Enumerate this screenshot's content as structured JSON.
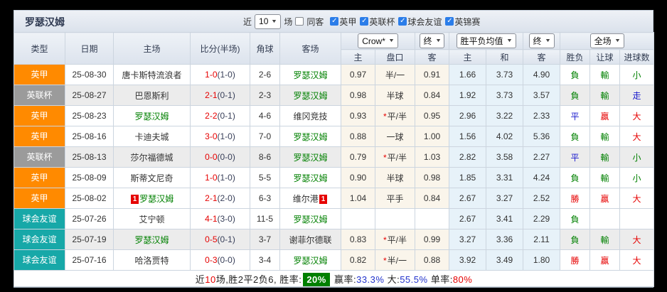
{
  "colors": {
    "league_badge": {
      "英甲": "#FF8A00",
      "英联杯": "#9B9B9B",
      "球会友谊": "#17A8A8"
    },
    "result_text": {
      "green": "#008000",
      "red": "#E60000",
      "blue": "#1717CC"
    },
    "team_highlight": "#008000",
    "team_normal": "#333333",
    "score_ft": "#E60000",
    "checkbox_checked": "#2B7DE9",
    "summary_badge_bg": "#008000"
  },
  "toolbar": {
    "team_title": "罗瑟汉姆",
    "recent_label": "近",
    "recent_value": "10",
    "matches_label": "场",
    "same_away_label": "同客",
    "same_away_checked": false,
    "leagues": [
      {
        "label": "英甲",
        "checked": true
      },
      {
        "label": "英联杯",
        "checked": true
      },
      {
        "label": "球会友谊",
        "checked": true
      },
      {
        "label": "英锦赛",
        "checked": true
      }
    ]
  },
  "header": {
    "col_type": "类型",
    "col_date": "日期",
    "col_home": "主场",
    "col_score": "比分(半场)",
    "col_corner": "角球",
    "col_away": "客场",
    "asian_bookmaker_select": "Crow*",
    "asian_time_select": "终",
    "asian_sub": [
      "主",
      "盘口",
      "客"
    ],
    "euro_type_select": "胜平负均值",
    "euro_time_select": "终",
    "euro_sub": [
      "主",
      "和",
      "客"
    ],
    "result_scope_select": "全场",
    "result_sub": [
      "胜负",
      "让球",
      "进球数"
    ]
  },
  "rows": [
    {
      "league": "英甲",
      "date": "25-08-30",
      "home": "唐卡斯特流浪者",
      "home_highlight": false,
      "home_red_card": "",
      "score_ft": "1-0",
      "score_ht": "(1-0)",
      "corners": "2-6",
      "away": "罗瑟汉姆",
      "away_highlight": true,
      "away_red_card": "",
      "ah_home": "0.97",
      "handicap": "半/一",
      "handicap_star": false,
      "ah_away": "0.91",
      "odds_home": "1.66",
      "odds_draw": "3.73",
      "odds_away": "4.90",
      "res_wdl": "負",
      "res_wdl_color": "green",
      "res_handicap": "輸",
      "res_handicap_color": "green",
      "res_goals": "小",
      "res_goals_color": "green",
      "shaded": false
    },
    {
      "league": "英联杯",
      "date": "25-08-27",
      "home": "巴恩斯利",
      "home_highlight": false,
      "home_red_card": "",
      "score_ft": "2-1",
      "score_ht": "(0-1)",
      "corners": "2-3",
      "away": "罗瑟汉姆",
      "away_highlight": true,
      "away_red_card": "",
      "ah_home": "0.98",
      "handicap": "半球",
      "handicap_star": false,
      "ah_away": "0.84",
      "odds_home": "1.92",
      "odds_draw": "3.73",
      "odds_away": "3.57",
      "res_wdl": "負",
      "res_wdl_color": "green",
      "res_handicap": "輸",
      "res_handicap_color": "green",
      "res_goals": "走",
      "res_goals_color": "blue",
      "shaded": true
    },
    {
      "league": "英甲",
      "date": "25-08-23",
      "home": "罗瑟汉姆",
      "home_highlight": true,
      "home_red_card": "",
      "score_ft": "2-2",
      "score_ht": "(0-1)",
      "corners": "4-6",
      "away": "维冈竞技",
      "away_highlight": false,
      "away_red_card": "",
      "ah_home": "0.93",
      "handicap": "平/半",
      "handicap_star": true,
      "ah_away": "0.95",
      "odds_home": "2.96",
      "odds_draw": "3.22",
      "odds_away": "2.33",
      "res_wdl": "平",
      "res_wdl_color": "blue",
      "res_handicap": "贏",
      "res_handicap_color": "red",
      "res_goals": "大",
      "res_goals_color": "red",
      "shaded": false
    },
    {
      "league": "英甲",
      "date": "25-08-16",
      "home": "卡迪夫城",
      "home_highlight": false,
      "home_red_card": "",
      "score_ft": "3-0",
      "score_ht": "(1-0)",
      "corners": "7-0",
      "away": "罗瑟汉姆",
      "away_highlight": true,
      "away_red_card": "",
      "ah_home": "0.88",
      "handicap": "一球",
      "handicap_star": false,
      "ah_away": "1.00",
      "odds_home": "1.56",
      "odds_draw": "4.02",
      "odds_away": "5.36",
      "res_wdl": "負",
      "res_wdl_color": "green",
      "res_handicap": "輸",
      "res_handicap_color": "green",
      "res_goals": "大",
      "res_goals_color": "red",
      "shaded": false
    },
    {
      "league": "英联杯",
      "date": "25-08-13",
      "home": "莎尔福德城",
      "home_highlight": false,
      "home_red_card": "",
      "score_ft": "0-0",
      "score_ht": "(0-0)",
      "corners": "8-6",
      "away": "罗瑟汉姆",
      "away_highlight": true,
      "away_red_card": "",
      "ah_home": "0.79",
      "handicap": "平/半",
      "handicap_star": true,
      "ah_away": "1.03",
      "odds_home": "2.82",
      "odds_draw": "3.58",
      "odds_away": "2.27",
      "res_wdl": "平",
      "res_wdl_color": "blue",
      "res_handicap": "輸",
      "res_handicap_color": "green",
      "res_goals": "小",
      "res_goals_color": "green",
      "shaded": true
    },
    {
      "league": "英甲",
      "date": "25-08-09",
      "home": "斯蒂文尼奇",
      "home_highlight": false,
      "home_red_card": "",
      "score_ft": "1-0",
      "score_ht": "(1-0)",
      "corners": "5-5",
      "away": "罗瑟汉姆",
      "away_highlight": true,
      "away_red_card": "",
      "ah_home": "0.90",
      "handicap": "半球",
      "handicap_star": false,
      "ah_away": "0.98",
      "odds_home": "1.85",
      "odds_draw": "3.31",
      "odds_away": "4.24",
      "res_wdl": "負",
      "res_wdl_color": "green",
      "res_handicap": "輸",
      "res_handicap_color": "green",
      "res_goals": "小",
      "res_goals_color": "green",
      "shaded": false
    },
    {
      "league": "英甲",
      "date": "25-08-02",
      "home": "罗瑟汉姆",
      "home_highlight": true,
      "home_red_card": "1",
      "score_ft": "2-1",
      "score_ht": "(2-0)",
      "corners": "6-3",
      "away": "维尔港",
      "away_highlight": false,
      "away_red_card": "1",
      "ah_home": "1.04",
      "handicap": "平手",
      "handicap_star": false,
      "ah_away": "0.84",
      "odds_home": "2.67",
      "odds_draw": "3.27",
      "odds_away": "2.52",
      "res_wdl": "勝",
      "res_wdl_color": "red",
      "res_handicap": "贏",
      "res_handicap_color": "red",
      "res_goals": "大",
      "res_goals_color": "red",
      "shaded": false
    },
    {
      "league": "球会友谊",
      "date": "25-07-26",
      "home": "艾宁顿",
      "home_highlight": false,
      "home_red_card": "",
      "score_ft": "4-1",
      "score_ht": "(3-0)",
      "corners": "11-5",
      "away": "罗瑟汉姆",
      "away_highlight": true,
      "away_red_card": "",
      "ah_home": "",
      "handicap": "",
      "handicap_star": false,
      "ah_away": "",
      "odds_home": "2.67",
      "odds_draw": "3.41",
      "odds_away": "2.29",
      "res_wdl": "負",
      "res_wdl_color": "green",
      "res_handicap": "",
      "res_handicap_color": "green",
      "res_goals": "",
      "res_goals_color": "green",
      "shaded": false
    },
    {
      "league": "球会友谊",
      "date": "25-07-19",
      "home": "罗瑟汉姆",
      "home_highlight": true,
      "home_red_card": "",
      "score_ft": "0-5",
      "score_ht": "(0-1)",
      "corners": "3-7",
      "away": "谢菲尔德联",
      "away_highlight": false,
      "away_red_card": "",
      "ah_home": "0.83",
      "handicap": "平/半",
      "handicap_star": true,
      "ah_away": "0.99",
      "odds_home": "3.27",
      "odds_draw": "3.36",
      "odds_away": "2.11",
      "res_wdl": "負",
      "res_wdl_color": "green",
      "res_handicap": "輸",
      "res_handicap_color": "green",
      "res_goals": "大",
      "res_goals_color": "red",
      "shaded": true
    },
    {
      "league": "球会友谊",
      "date": "25-07-16",
      "home": "哈洛贾特",
      "home_highlight": false,
      "home_red_card": "",
      "score_ft": "0-3",
      "score_ht": "(0-0)",
      "corners": "3-4",
      "away": "罗瑟汉姆",
      "away_highlight": true,
      "away_red_card": "",
      "ah_home": "0.82",
      "handicap": "半/一",
      "handicap_star": true,
      "ah_away": "0.88",
      "odds_home": "3.92",
      "odds_draw": "3.49",
      "odds_away": "1.80",
      "res_wdl": "勝",
      "res_wdl_color": "red",
      "res_handicap": "贏",
      "res_handicap_color": "red",
      "res_goals": "大",
      "res_goals_color": "red",
      "shaded": false
    }
  ],
  "summary": {
    "segments": [
      {
        "text": "近",
        "style": "plain"
      },
      {
        "text": "10",
        "style": "red"
      },
      {
        "text": "场,胜2平2负6, 胜率:",
        "style": "plain"
      },
      {
        "text": "20%",
        "style": "badge"
      },
      {
        "text": " 赢率:",
        "style": "plain"
      },
      {
        "text": "33.3%",
        "style": "blue"
      },
      {
        "text": " 大:",
        "style": "plain"
      },
      {
        "text": "55.5%",
        "style": "blue"
      },
      {
        "text": " 单率:",
        "style": "plain"
      },
      {
        "text": "80%",
        "style": "red"
      }
    ]
  }
}
